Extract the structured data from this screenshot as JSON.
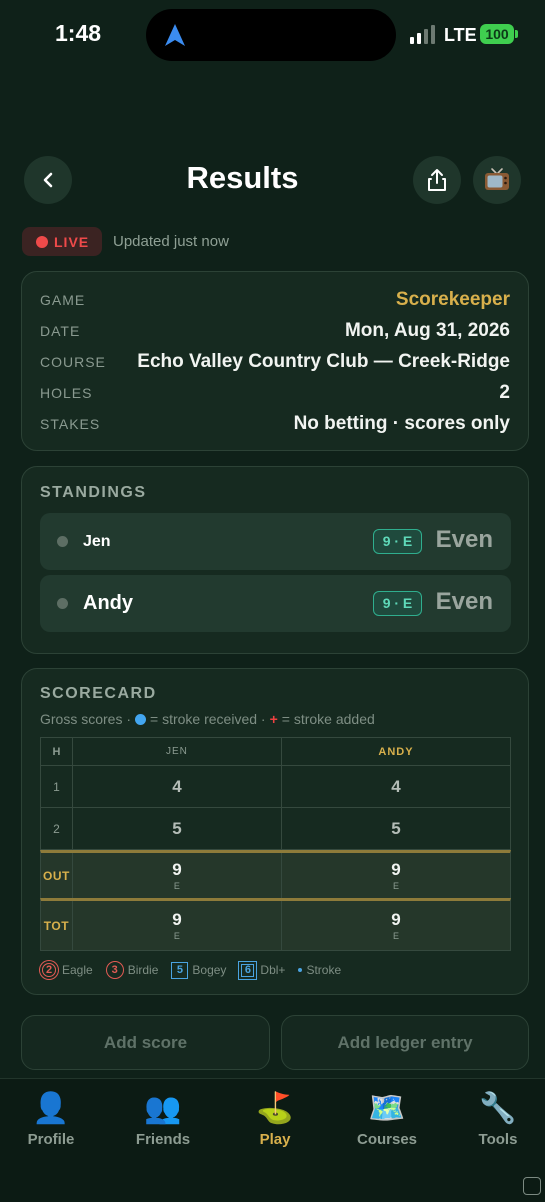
{
  "status_bar": {
    "time": "1:48",
    "network": "LTE",
    "battery": "100"
  },
  "header": {
    "title": "Results",
    "back_icon": "chevron-left-icon",
    "share_icon": "share-icon",
    "tv_icon": "tv-icon"
  },
  "live": {
    "badge": "LIVE",
    "updated": "Updated just now"
  },
  "info": {
    "rows": [
      {
        "label": "GAME",
        "value": "Scorekeeper"
      },
      {
        "label": "DATE",
        "value": "Mon, Aug 31, 2026"
      },
      {
        "label": "COURSE",
        "value": "Echo Valley Country Club — Creek-Ridge"
      },
      {
        "label": "HOLES",
        "value": "2"
      },
      {
        "label": "STAKES",
        "value": "No betting · scores only"
      }
    ]
  },
  "standings": {
    "title": "STANDINGS",
    "players": [
      {
        "name": "Jen",
        "pill": "9 · E",
        "score": "Even"
      },
      {
        "name": "Andy",
        "pill": "9 · E",
        "score": "Even"
      }
    ]
  },
  "scorecard": {
    "title": "SCORECARD",
    "sub_prefix": "Gross scores ·",
    "sub_received": "= stroke received ·",
    "sub_plus": "+",
    "sub_added": "= stroke added",
    "headers": {
      "hole": "H",
      "p1": "JEN",
      "p2": "ANDY"
    },
    "holes": [
      {
        "hole": "1",
        "p1": "4",
        "p2": "4"
      },
      {
        "hole": "2",
        "p1": "5",
        "p2": "5"
      }
    ],
    "out": {
      "label": "OUT",
      "p1": "9",
      "p1_sub": "E",
      "p2": "9",
      "p2_sub": "E"
    },
    "tot": {
      "label": "TOT",
      "p1": "9",
      "p1_sub": "E",
      "p2": "9",
      "p2_sub": "E"
    },
    "legend": {
      "eagle_num": "2",
      "eagle": "Eagle",
      "birdie_num": "3",
      "birdie": "Birdie",
      "bogey_num": "5",
      "bogey": "Bogey",
      "dbl_num": "6",
      "dbl": "Dbl+",
      "stroke": "Stroke"
    }
  },
  "actions": {
    "add_score": "Add score",
    "add_ledger": "Add ledger entry"
  },
  "tabs": [
    {
      "label": "Profile",
      "icon": "👤"
    },
    {
      "label": "Friends",
      "icon": "👥"
    },
    {
      "label": "Play",
      "icon": "⛳"
    },
    {
      "label": "Courses",
      "icon": "🗺️"
    },
    {
      "label": "Tools",
      "icon": "🔧"
    }
  ],
  "colors": {
    "accent_gold": "#d8b04c",
    "live_red": "#ef4a4a",
    "teal": "#5fd9b9",
    "background": "#0f2119"
  }
}
